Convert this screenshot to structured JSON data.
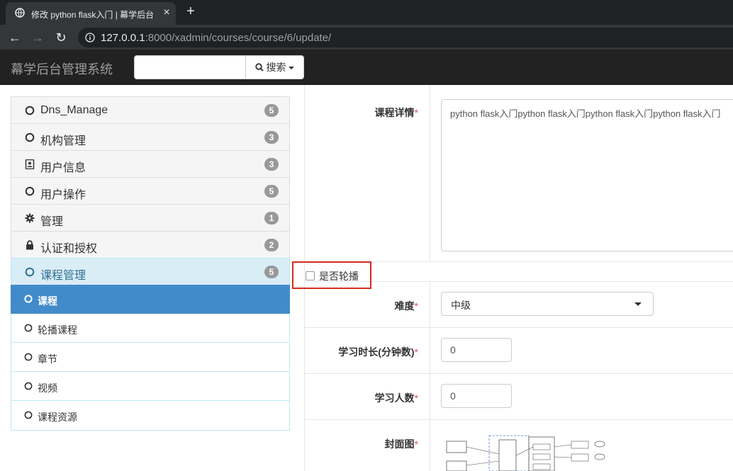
{
  "browser": {
    "tab_title": "修改 python flask入门 | 幕学后台",
    "url_host": "127.0.0.1",
    "url_rest": ":8000/xadmin/courses/course/6/update/"
  },
  "navbar": {
    "brand": "幕学后台管理系统",
    "search_button": "搜索"
  },
  "sidebar": {
    "items": [
      {
        "label": "Dns_Manage",
        "badge": "5",
        "icon": "circle-icon"
      },
      {
        "label": "机构管理",
        "badge": "3",
        "icon": "circle-icon"
      },
      {
        "label": "用户信息",
        "badge": "3",
        "icon": "contact-card-icon"
      },
      {
        "label": "用户操作",
        "badge": "5",
        "icon": "circle-icon"
      },
      {
        "label": "管理",
        "badge": "1",
        "icon": "gear-icon"
      },
      {
        "label": "认证和授权",
        "badge": "2",
        "icon": "lock-icon"
      },
      {
        "label": "课程管理",
        "badge": "5",
        "icon": "circle-icon"
      }
    ],
    "subitems": [
      {
        "label": "课程",
        "active": true
      },
      {
        "label": "轮播课程"
      },
      {
        "label": "章节"
      },
      {
        "label": "视频"
      },
      {
        "label": "课程资源"
      }
    ]
  },
  "form": {
    "detail_label": "课程详情",
    "detail_value": "python flask入门python flask入门python flask入门python flask入门",
    "banner_label": "是否轮播",
    "difficulty_label": "难度",
    "difficulty_value": "中级",
    "duration_label": "学习时长(分钟数)",
    "duration_value": "0",
    "students_label": "学习人数",
    "students_value": "0",
    "cover_label": "封面图",
    "required_mark": "*"
  }
}
